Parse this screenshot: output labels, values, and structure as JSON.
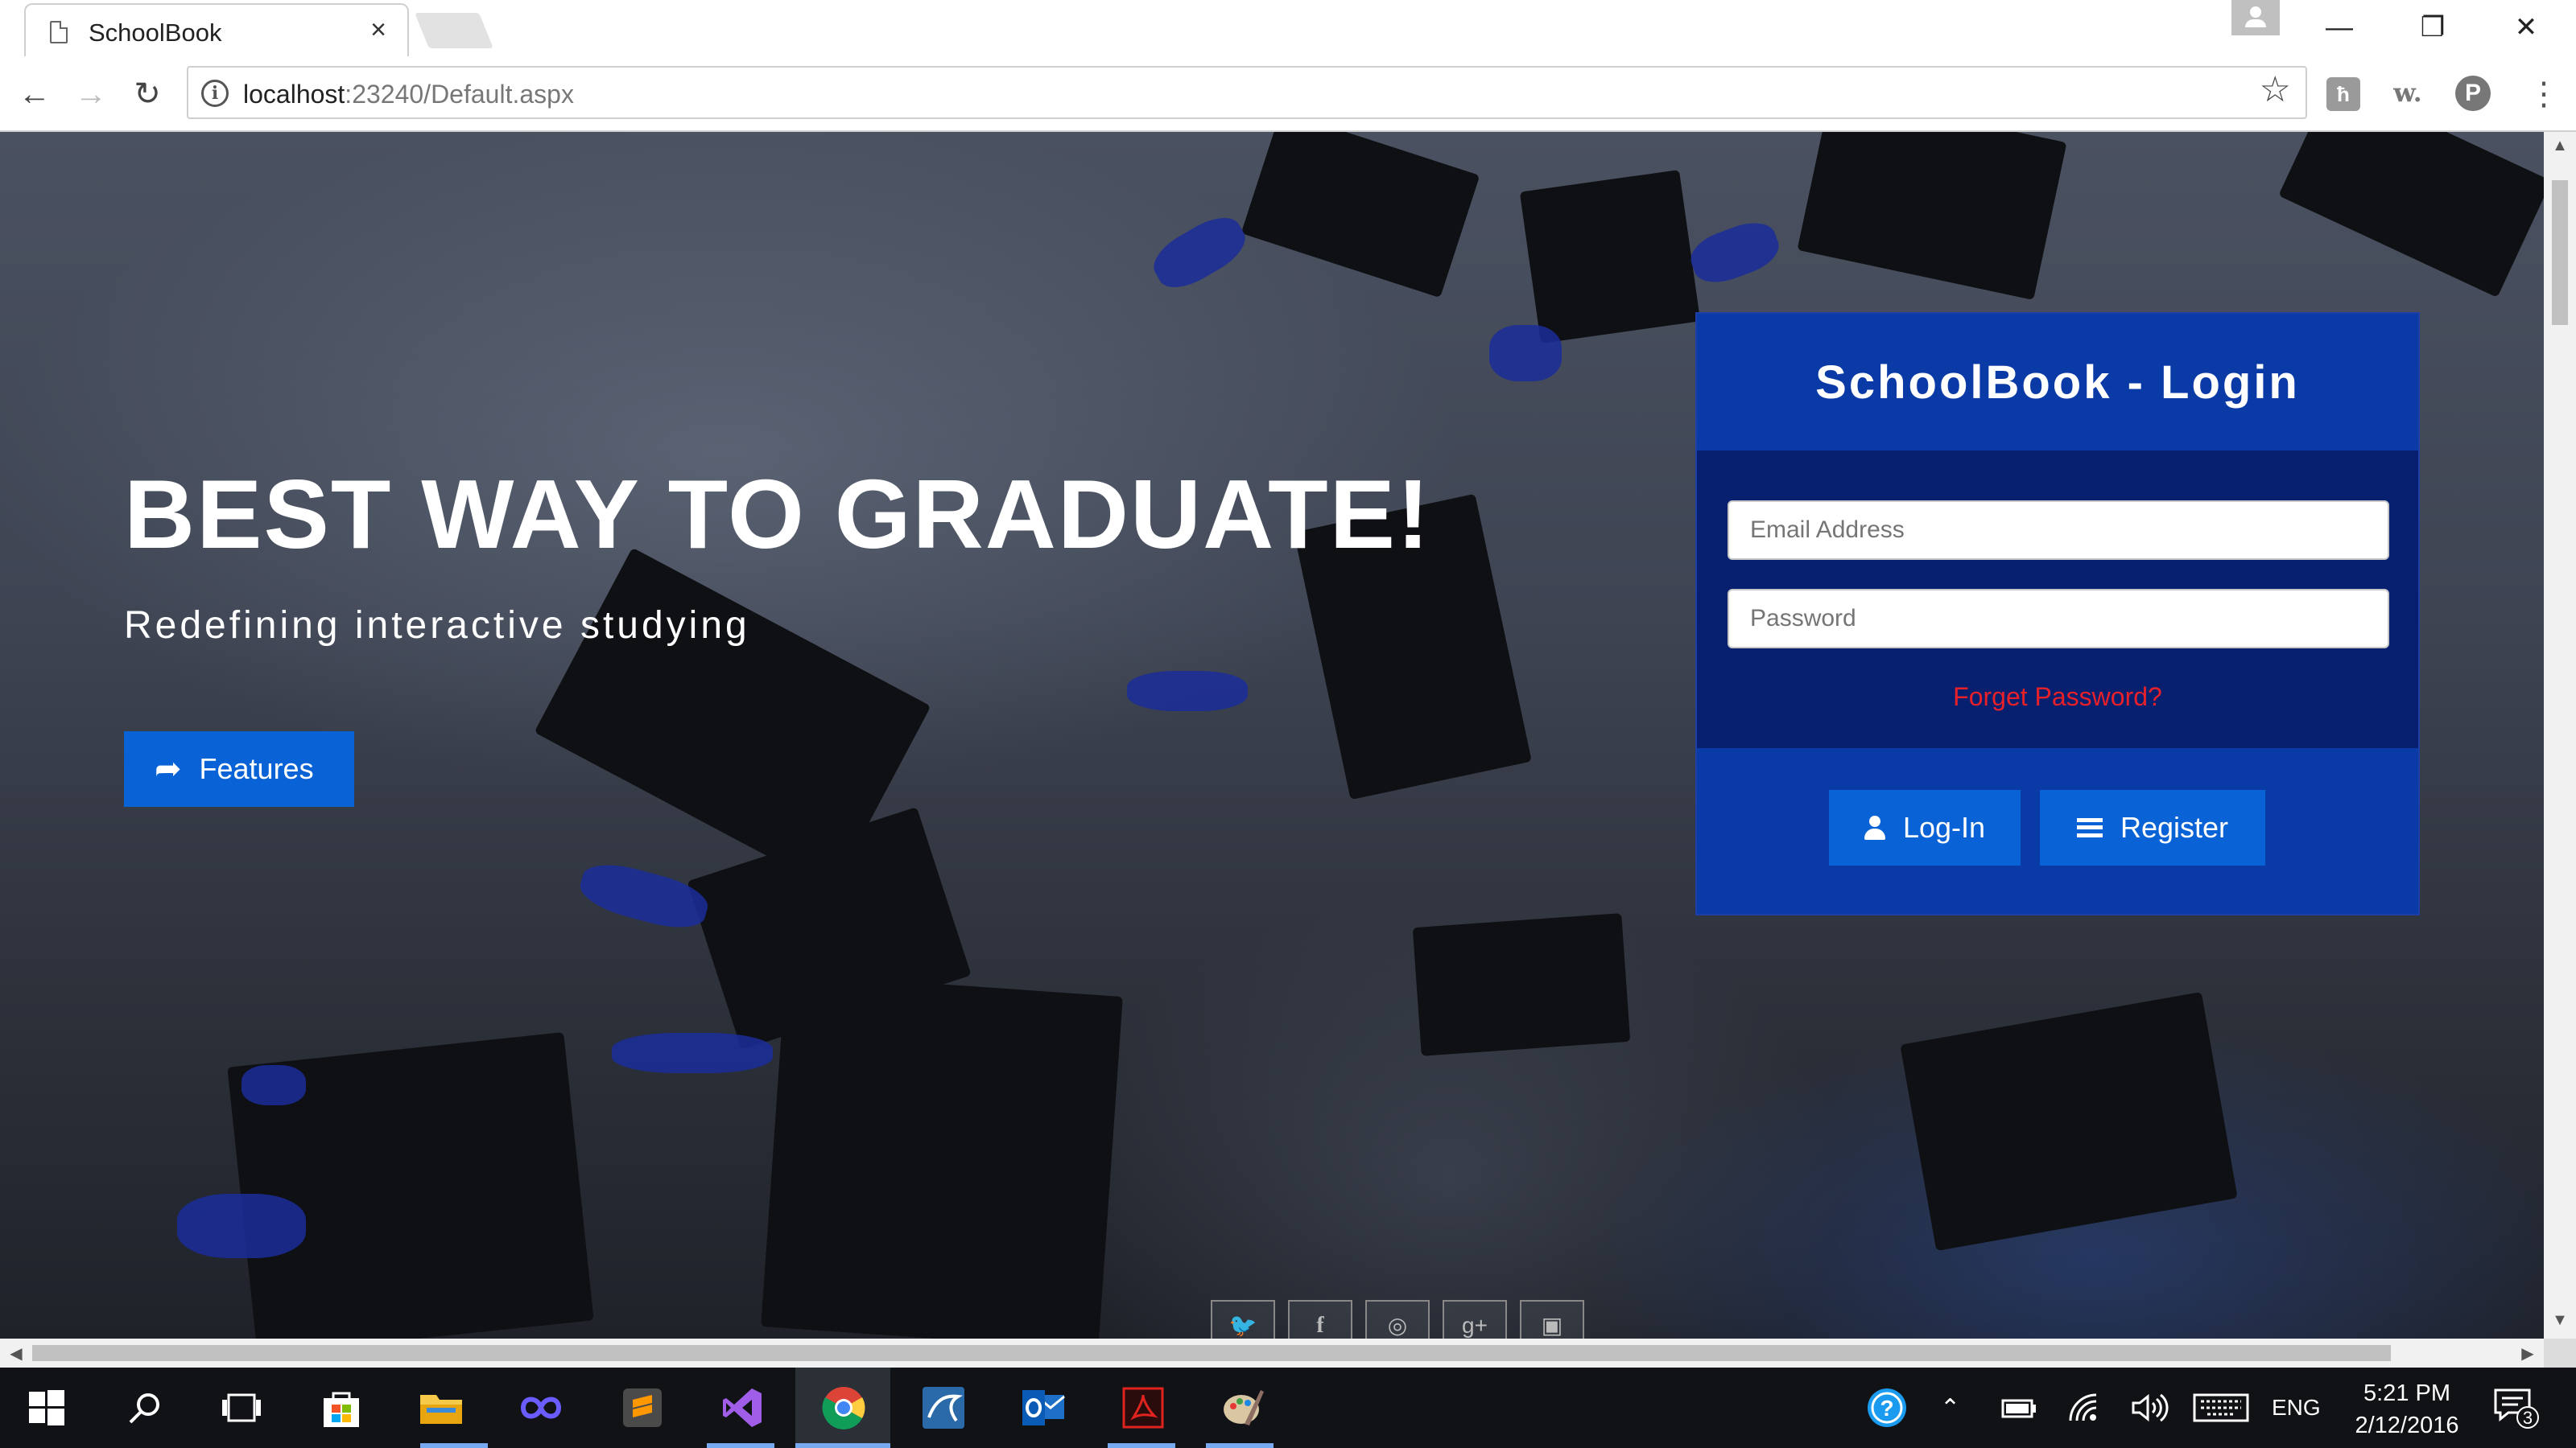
{
  "browser": {
    "tab_title": "SchoolBook",
    "tab_close": "×",
    "url_host": "localhost",
    "url_rest": ":23240/Default.aspx",
    "back": "←",
    "forward": "→",
    "reload": "↻",
    "star": "☆",
    "extensions": [
      "ћ",
      "w.",
      "P"
    ],
    "menu": "⋮",
    "window_controls": {
      "minimize": "—",
      "maximize": "❐",
      "close": "✕"
    }
  },
  "hero": {
    "title": "BEST WAY TO GRADUATE!",
    "subtitle": "Redefining interactive studying",
    "features_label": "Features"
  },
  "login": {
    "title": "SchoolBook - Login",
    "email_placeholder": "Email Address",
    "password_placeholder": "Password",
    "forgot_label": "Forget Password?",
    "login_label": "Log-In",
    "register_label": "Register"
  },
  "social_icons": [
    "twitter-icon",
    "facebook-icon",
    "dribbble-icon",
    "google-plus-icon",
    "instagram-icon"
  ],
  "taskbar": {
    "language": "ENG",
    "time": "5:21 PM",
    "date": "2/12/2016",
    "notification_count": "3"
  },
  "colors": {
    "brand_blue": "#0a63d6",
    "panel_blue": "#0a3aa6",
    "panel_dark": "#06206f",
    "forgot_red": "#e8202a"
  }
}
